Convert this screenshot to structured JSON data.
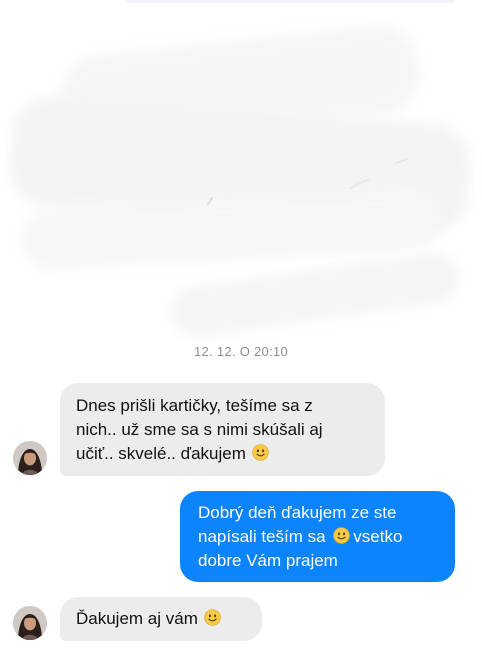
{
  "conversation": {
    "timestamp": "12. 12. O 20:10",
    "messages": [
      {
        "direction": "incoming",
        "lines": [
          "Dnes prišli kartičky, tešíme sa z",
          "nich.. už sme sa s nimi skúšali aj",
          "učiť.. skvelé.. ďakujem"
        ],
        "trailing_emoji": "slightly-smiling-face"
      },
      {
        "direction": "outgoing",
        "lines": [
          "Dobrý deň ďakujem ze ste",
          "napísali teším sa",
          "vsetko",
          "dobre Vám prajem"
        ],
        "inline_emoji": "slightly-smiling-face"
      },
      {
        "direction": "incoming",
        "lines": [
          "Ďakujem aj vám"
        ],
        "trailing_emoji": "slightly-smiling-face"
      }
    ]
  },
  "colors": {
    "incoming_bubble": "#ececed",
    "outgoing_bubble": "#0b84fe",
    "timestamp_text": "#8e8e93",
    "emoji_face": "#f7c948"
  },
  "icons": {
    "emoji": "slightly-smiling-face-icon",
    "avatar": "contact-avatar"
  }
}
